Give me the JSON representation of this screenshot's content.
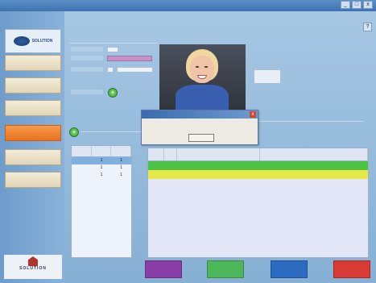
{
  "window": {
    "title": "",
    "controls": [
      "_",
      "□",
      "x"
    ],
    "help_label": "?"
  },
  "sidebar": {
    "logo_text": "SOLUTION",
    "items": [
      {
        "label": ""
      },
      {
        "label": ""
      },
      {
        "label": ""
      },
      {
        "label": ""
      },
      {
        "label": ""
      },
      {
        "label": ""
      }
    ],
    "footer_logo": {
      "name": "SOLUTION",
      "tagline": ""
    }
  },
  "form": {
    "section1_title": "",
    "section2_title": ""
  },
  "dialog": {
    "message": "",
    "ok_label": ""
  },
  "small_grid": {
    "headers": [
      "",
      "",
      ""
    ],
    "rows": [
      [
        "",
        "1",
        "1"
      ],
      [
        "",
        "1",
        "1"
      ],
      [
        "",
        "1",
        "1"
      ]
    ]
  },
  "main_grid": {
    "headers": [
      "",
      "",
      "",
      ""
    ],
    "rows": [
      {
        "cells": [
          "",
          "",
          "",
          ""
        ],
        "color": "green"
      },
      {
        "cells": [
          "",
          "",
          "",
          ""
        ],
        "color": "yellow"
      }
    ]
  },
  "bottom_buttons": [
    {
      "label": "",
      "color": "#8a3fa8"
    },
    {
      "label": "",
      "color": "#4cb85a"
    },
    {
      "label": "",
      "color": "#2b6cc0"
    },
    {
      "label": "",
      "color": "#d83a34"
    }
  ],
  "colors": {
    "active_item": "#e8721f",
    "green_row": "#4cc244",
    "yellow_row": "#e6e84a"
  }
}
